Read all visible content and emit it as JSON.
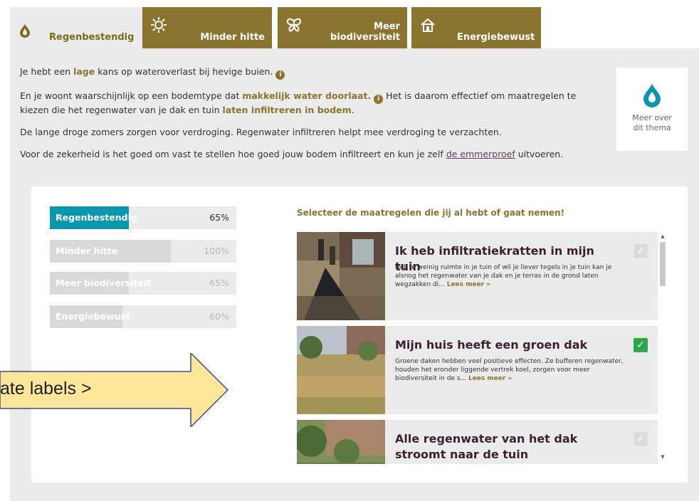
{
  "tabs": [
    {
      "label": "Regenbestendig",
      "icon": "water-drop-icon"
    },
    {
      "label": "Minder hitte",
      "icon": "sun-icon"
    },
    {
      "label_line1": "Meer",
      "label_line2": "biodiversiteit",
      "icon": "butterfly-icon"
    },
    {
      "label": "Energiebewust",
      "icon": "house-icon"
    }
  ],
  "intro": {
    "p1_a": "Je hebt een ",
    "p1_hl": "lage",
    "p1_b": " kans op wateroverlast bij hevige buien.",
    "p2_a": "En je woont waarschijnlijk op een bodemtype dat ",
    "p2_hl1": "makkelijk water doorlaat.",
    "p2_b": " Het is daarom effectief om maatregelen te kiezen die het regenwater van je dak en tuin ",
    "p2_hl2": "laten infiltreren in bodem",
    "p2_c": ".",
    "p3": "De lange droge zomers zorgen voor verdroging. Regenwater infiltreren helpt mee verdroging te verzachten.",
    "p4_a": "Voor de zekerheid is het goed om vast te stellen hoe goed jouw bodem infiltreert en kun je zelf ",
    "p4_link": "de emmerproef",
    "p4_b": " uitvoeren."
  },
  "theme_link": {
    "line1": "Meer over",
    "line2": "dit thema"
  },
  "scores": [
    {
      "label": "Regenbestendig",
      "pct": "65%",
      "fill": 0.65,
      "active": true
    },
    {
      "label": "Minder hitte",
      "pct": "100%",
      "fill": 1.0,
      "active": false
    },
    {
      "label": "Meer biodiversiteit",
      "pct": "65%",
      "fill": 0.65,
      "active": false
    },
    {
      "label": "Energiebewust",
      "pct": "60%",
      "fill": 0.6,
      "active": false
    }
  ],
  "select_title": "Selecteer de maatregelen die jij al hebt of gaat nemen!",
  "measures": [
    {
      "title": "Ik heb infiltratiekratten in mijn tuin",
      "desc": "Heb je weinig ruimte in je tuin of wil je liever tegels in je tuin kan je alsnog het regenwater van je dak en je terras in de grond laten wegzakken di... ",
      "more": "Lees meer »",
      "checked": false
    },
    {
      "title": "Mijn huis heeft een groen dak",
      "desc": "Groene daken hebben veel positieve effecten. Ze bufferen regenwater, houden het eronder liggende vertrek koel, zorgen voor meer biodiversiteit in de s... ",
      "more": "Lees meer »",
      "checked": true
    },
    {
      "title": "Alle regenwater van het dak stroomt naar de tuin",
      "desc": "",
      "more": "",
      "checked": false
    }
  ],
  "callout": {
    "text": "ate labels >"
  },
  "colors": {
    "tab_brown": "#8b7430",
    "active_bar": "#0a97ad",
    "inactive_bar": "#d9d9d9",
    "check_green": "#2aa84a",
    "check_grey": "#dcdcdc",
    "title_purple": "#3d1f2f",
    "callout_fill": "#fde59a",
    "callout_stroke": "#3b4f8a"
  }
}
